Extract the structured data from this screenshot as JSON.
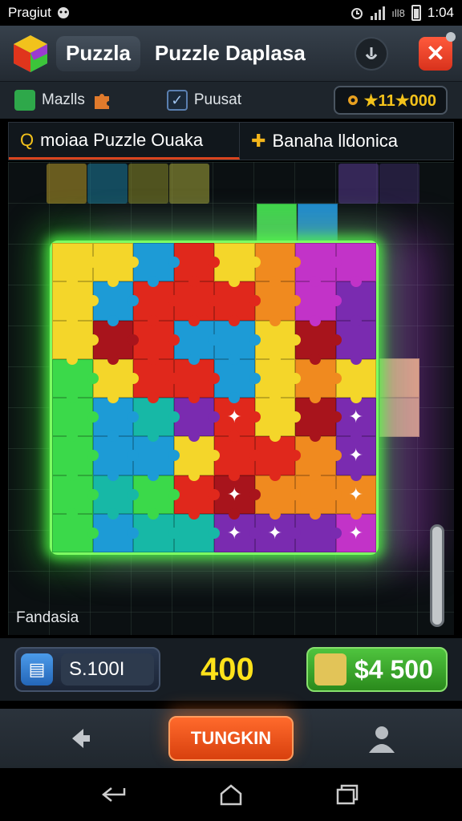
{
  "status_bar": {
    "carrier": "Pragiut",
    "time": "1:04",
    "net_label": "ıll8"
  },
  "header": {
    "app_name": "Puzzla",
    "title": "Puzzle Daplasa",
    "info_icon": "info-icon",
    "close_icon": "close-icon"
  },
  "toolbar": {
    "item1_label": "Mazlls",
    "item2_label": "Puusat",
    "score": "★11★000"
  },
  "tabs": [
    {
      "lead": "Q",
      "label": "moiaa Puzzle Ouaka",
      "active": true
    },
    {
      "lead": "✚",
      "label": "Banaha lldonica",
      "active": false
    }
  ],
  "board": {
    "level_label": "Fandasia",
    "colors": {
      "yellow": "#f4d62a",
      "red": "#e0281c",
      "blue": "#1d9bd6",
      "green": "#3bd94a",
      "orange": "#f08a1f",
      "magenta": "#c233c8",
      "purple": "#7a2bb0",
      "crimson": "#a8141c",
      "teal": "#17b8a6"
    },
    "grid": [
      [
        "yellow",
        "yellow",
        "blue",
        "red",
        "yellow",
        "orange",
        "magenta",
        "magenta"
      ],
      [
        "yellow",
        "blue",
        "red",
        "red",
        "red",
        "orange",
        "magenta",
        "purple"
      ],
      [
        "yellow",
        "crimson",
        "red",
        "blue",
        "blue",
        "yellow",
        "crimson",
        "purple"
      ],
      [
        "green",
        "yellow",
        "red",
        "red",
        "blue",
        "yellow",
        "orange",
        "yellow"
      ],
      [
        "green",
        "blue",
        "teal",
        "purple",
        "red",
        "yellow",
        "crimson",
        "purple"
      ],
      [
        "green",
        "blue",
        "blue",
        "yellow",
        "red",
        "red",
        "orange",
        "purple"
      ],
      [
        "green",
        "teal",
        "green",
        "red",
        "crimson",
        "orange",
        "orange",
        "orange"
      ],
      [
        "green",
        "blue",
        "teal",
        "teal",
        "purple",
        "purple",
        "purple",
        "magenta"
      ]
    ],
    "star_cells": [
      [
        4,
        4
      ],
      [
        4,
        7
      ],
      [
        5,
        7
      ],
      [
        6,
        4
      ],
      [
        6,
        7
      ],
      [
        7,
        4
      ],
      [
        7,
        5
      ],
      [
        7,
        7
      ]
    ]
  },
  "bottom": {
    "balance": "S.100I",
    "center_score": "400",
    "buy_price": "$4 500"
  },
  "nav": {
    "cta_label": "TUNGKIN"
  }
}
